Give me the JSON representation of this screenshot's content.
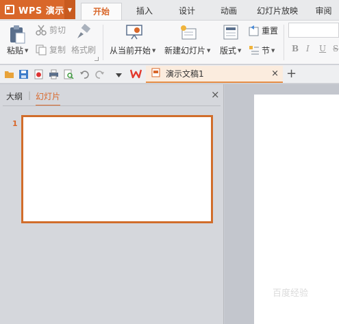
{
  "app": {
    "name": "WPS 演示"
  },
  "tabs": [
    {
      "label": "开始",
      "active": true
    },
    {
      "label": "插入"
    },
    {
      "label": "设计"
    },
    {
      "label": "动画"
    },
    {
      "label": "幻灯片放映"
    },
    {
      "label": "审阅"
    }
  ],
  "ribbon": {
    "paste": "粘贴",
    "cut": "剪切",
    "copy": "复制",
    "format_painter": "格式刷",
    "from_current": "从当前开始",
    "new_slide": "新建幻灯片",
    "layout": "版式",
    "reset": "重置",
    "section": "节",
    "bold": "B",
    "italic": "I",
    "underline": "U",
    "strike": "S"
  },
  "document": {
    "tab_title": "演示文稿1",
    "close": "×",
    "new_tab": "+"
  },
  "left_pane": {
    "outline_tab": "大纲",
    "separator": "|",
    "slides_tab": "幻灯片",
    "close": "×",
    "slide_number": "1"
  },
  "colors": {
    "accent": "#d9672a",
    "thumb_border": "#d16d2b"
  },
  "watermark": "百度经验"
}
